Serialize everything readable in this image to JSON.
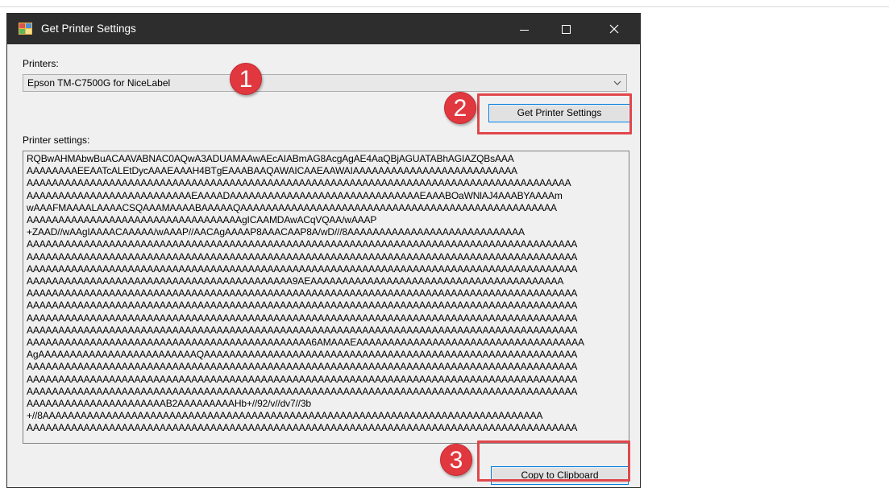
{
  "window": {
    "title": "Get Printer Settings",
    "controls": [
      "minimize",
      "maximize",
      "close"
    ]
  },
  "printers": {
    "label": "Printers:",
    "selected": "Epson TM-C7500G for NiceLabel"
  },
  "buttons": {
    "get_settings": "Get Printer Settings",
    "copy": "Copy to Clipboard"
  },
  "settings": {
    "label": "Printer settings:",
    "lines": [
      "RQBwAHMAbwBuACAAVABNAC0AQwA3ADUAMAAwAEcAIABmAG8AcgAgAE4AaQBjAGUATABhAGIAZQBsAAA",
      "AAAAAAAAEEAATcALEtDycAAAEAAAH4BTgEAAABAAQAWAICAAEAAWAIAAAAAAAAAAAAAAAAAAAAAAAAAA",
      "AAAAAAAAAAAAAAAAAAAAAAAAAAAAAAAAAAAAAAAAAAAAAAAAAAAAAAAAAAAAAAAAAAAAAAAAAAAAAAAAAAAAAA",
      "AAAAAAAAAAAAAAAAAAAAAAAAAAEAAAADAAAAAAAAAAAAAAAAAAAAAAAAAAAAAAEAAABOaWNlAJ4AAABYAAAAm",
      "wAAAFMAAAALAAAACSQAAAMAAAABAAAAAQAAAAAAAAAAAAAAAAAAAAAAAAAAAAAAAAAAAAAAAAAAAAAAAAAA",
      "AAAAAAAAAAAAAAAAAAAAAAAAAAAAAAAAAAgICAAMDAwACqVQAA/wAAAP",
      "+ZAAD//wAAgIAAAACAAAAA/wAAAP//AACAgAAAAP8AAACAAP8A/wD///8AAAAAAAAAAAAAAAAAAAAAAAAAAAA",
      "AAAAAAAAAAAAAAAAAAAAAAAAAAAAAAAAAAAAAAAAAAAAAAAAAAAAAAAAAAAAAAAAAAAAAAAAAAAAAAAAAAAAAAA",
      "AAAAAAAAAAAAAAAAAAAAAAAAAAAAAAAAAAAAAAAAAAAAAAAAAAAAAAAAAAAAAAAAAAAAAAAAAAAAAAAAAAAAAAA",
      "AAAAAAAAAAAAAAAAAAAAAAAAAAAAAAAAAAAAAAAAAAAAAAAAAAAAAAAAAAAAAAAAAAAAAAAAAAAAAAAAAAAAAAA",
      "AAAAAAAAAAAAAAAAAAAAAAAAAAAAAAAAAAAAAAAAAA9AEAAAAAAAAAAAAAAAAAAAAAAAAAAAAAAAAAAAAAAAA",
      "AAAAAAAAAAAAAAAAAAAAAAAAAAAAAAAAAAAAAAAAAAAAAAAAAAAAAAAAAAAAAAAAAAAAAAAAAAAAAAAAAAAAAAA",
      "AAAAAAAAAAAAAAAAAAAAAAAAAAAAAAAAAAAAAAAAAAAAAAAAAAAAAAAAAAAAAAAAAAAAAAAAAAAAAAAAAAAAAAA",
      "AAAAAAAAAAAAAAAAAAAAAAAAAAAAAAAAAAAAAAAAAAAAAAAAAAAAAAAAAAAAAAAAAAAAAAAAAAAAAAAAAAAAAAA",
      "AAAAAAAAAAAAAAAAAAAAAAAAAAAAAAAAAAAAAAAAAAAAAAAAAAAAAAAAAAAAAAAAAAAAAAAAAAAAAAAAAAAAAAA",
      "AAAAAAAAAAAAAAAAAAAAAAAAAAAAAAAAAAAAAAAAAAAAA6AMAAAEAAAAAAAAAAAAAAAAAAAAAAAAAAAAAAAAAAAA",
      "AgAAAAAAAAAAAAAAAAAAAAAAAAAQAAAAAAAAAAAAAAAAAAAAAAAAAAAAAAAAAAAAAAAAAAAAAAAAAAAAAAAAAAA",
      "AAAAAAAAAAAAAAAAAAAAAAAAAAAAAAAAAAAAAAAAAAAAAAAAAAAAAAAAAAAAAAAAAAAAAAAAAAAAAAAAAAAAAAA",
      "AAAAAAAAAAAAAAAAAAAAAAAAAAAAAAAAAAAAAAAAAAAAAAAAAAAAAAAAAAAAAAAAAAAAAAAAAAAAAAAAAAAAAAA",
      "AAAAAAAAAAAAAAAAAAAAAAAAAAAAAAAAAAAAAAAAAAAAAAAAAAAAAAAAAAAAAAAAAAAAAAAAAAAAAAAAAAAAAAA",
      "AAAAAAAAAAAAAAAAAAAAAAB2AAAAAAAAAHb+//92/v//dv7//3b",
      "+//8AAAAAAAAAAAAAAAAAAAAAAAAAAAAAAAAAAAAAAAAAAAAAAAAAAAAAAAAAAAAAAAAAAAAAAAAAAAAAAA",
      "AAAAAAAAAAAAAAAAAAAAAAAAAAAAAAAAAAAAAAAAAAAAAAAAAAAAAAAAAAAAAAAAAAAAAAAAAAAAAAAAAAAAAAA"
    ]
  },
  "steps": {
    "one": "1",
    "two": "2",
    "three": "3"
  },
  "colors": {
    "titlebar": "#2d2d2d",
    "highlight": "#e0474c",
    "badge": "#e1383f",
    "button_border": "#0078d7"
  }
}
